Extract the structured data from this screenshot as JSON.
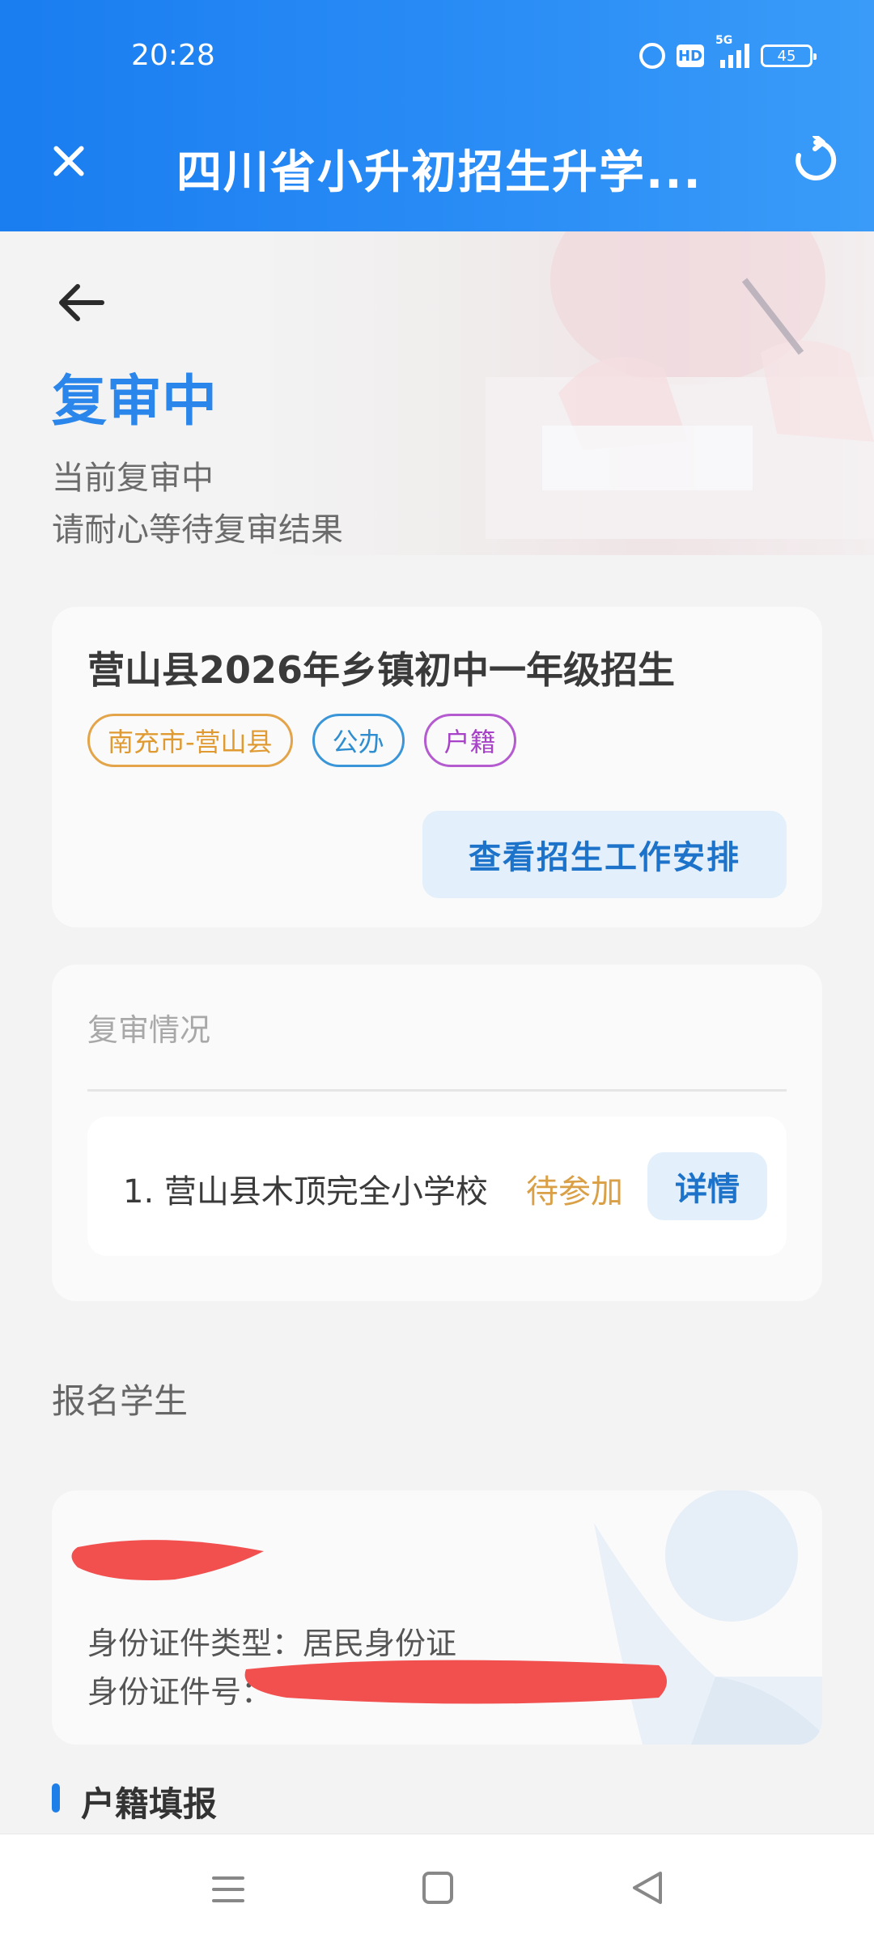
{
  "status_bar": {
    "time": "20:28",
    "icons": [
      "alarm-icon",
      "hd-icon",
      "5g-signal-icon",
      "battery-icon"
    ],
    "network": "5G",
    "hd": "HD",
    "battery": "45"
  },
  "header": {
    "title": "四川省小升初招生升学...",
    "close_icon": "close-icon",
    "refresh_icon": "refresh-icon",
    "color": "#2b8ef6"
  },
  "hero": {
    "back_icon": "back-arrow-icon",
    "status": "复审中",
    "line1": "当前复审中",
    "line2": "请耐心等待复审结果"
  },
  "project_card": {
    "title": "营山县2026年乡镇初中一年级招生",
    "tags": [
      "南充市-营山县",
      "公办",
      "户籍"
    ],
    "schedule_button": "查看招生工作安排"
  },
  "review_card": {
    "label": "复审情况",
    "schools": [
      {
        "name": "1. 营山县木顶完全小学校",
        "status": "待参加",
        "detail_button": "详情"
      }
    ]
  },
  "students": {
    "label": "报名学生",
    "student": {
      "name": "",
      "id_type_line": "身份证件类型：居民身份证",
      "id_number_line": "身份证件号："
    }
  },
  "household_section": {
    "title": "户籍填报"
  },
  "nav_bar": {
    "icons": [
      "menu-icon",
      "home-icon",
      "back-icon"
    ]
  },
  "colors": {
    "accent": "#2a86ea",
    "pending": "#d9a047",
    "tag_orange": "#e09a32",
    "tag_blue": "#2f8ecf",
    "tag_purple": "#a842c8",
    "redaction": "#f24f4f"
  }
}
